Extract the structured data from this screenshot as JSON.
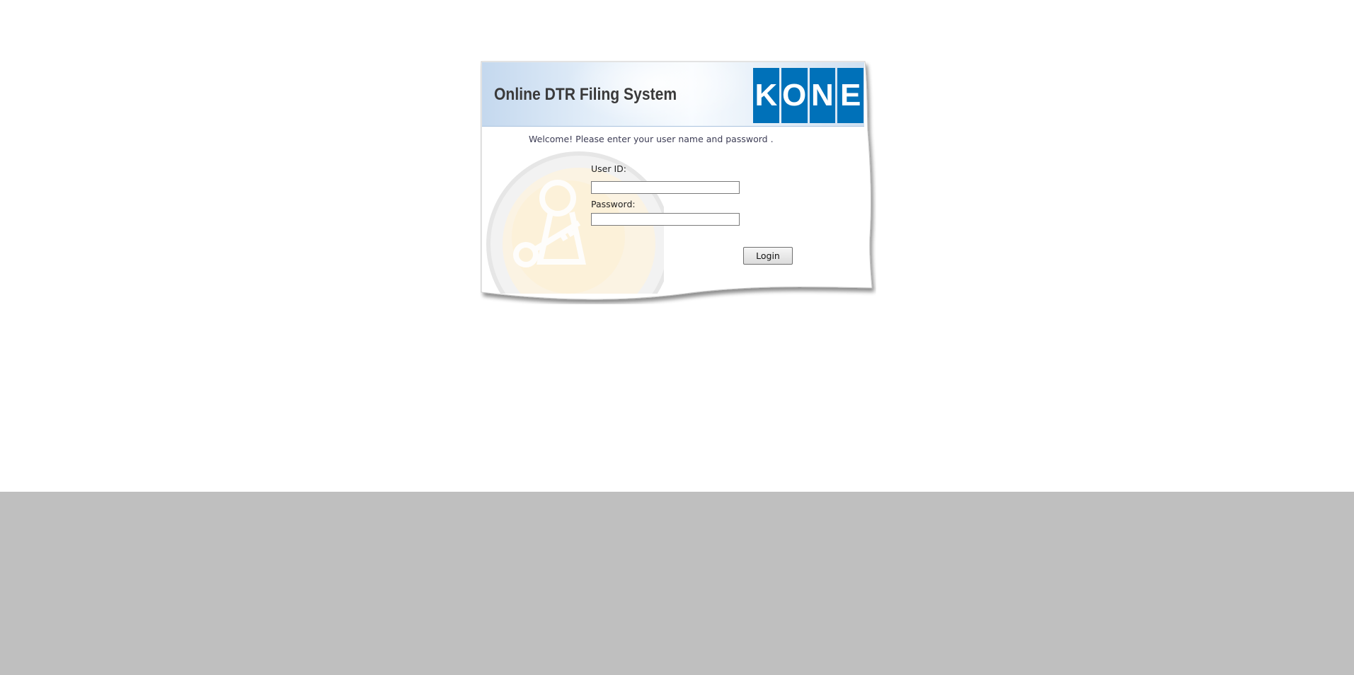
{
  "header": {
    "title": "Online DTR Filing System",
    "logo_letters": [
      "K",
      "O",
      "N",
      "E"
    ],
    "logo_color": "#0071b9"
  },
  "form": {
    "welcome": "Welcome! Please enter your user name and password .",
    "user_id_label": "User ID:",
    "user_id_value": "",
    "password_label": "Password:",
    "password_value": "",
    "login_label": "Login"
  },
  "watermark_icon": "key-lock-icon"
}
